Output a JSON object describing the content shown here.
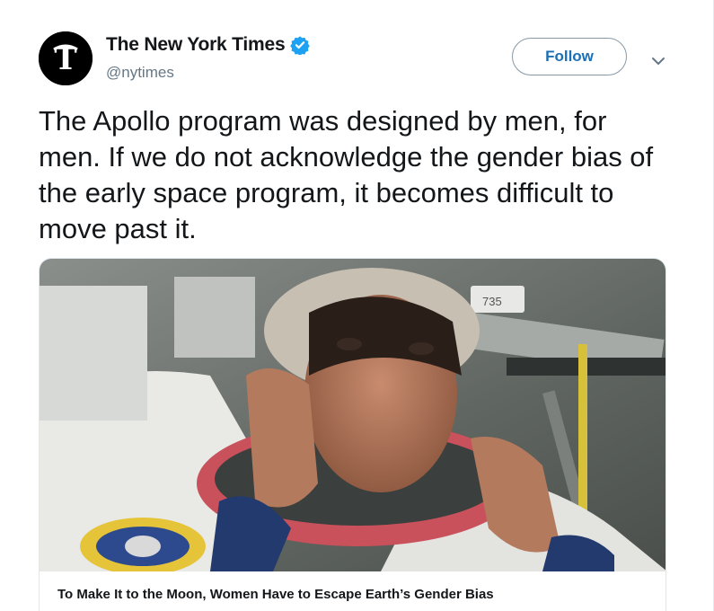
{
  "user": {
    "display_name": "The New York Times",
    "handle": "@nytimes",
    "avatar_icon": "nyt-logo-icon",
    "verified": true
  },
  "actions": {
    "follow_label": "Follow",
    "menu_icon": "chevron-down-icon"
  },
  "tweet": {
    "text": "The Apollo program was designed by men, for men. If we do not acknowledge the gender bias of the early space program, it becomes difficult to move past it."
  },
  "card": {
    "title": "To Make It to the Moon, Women Have to Escape Earth’s Gender Bias",
    "image_label": "735"
  },
  "colors": {
    "follow_text": "#1b6fb5",
    "verified": "#1da1f2",
    "handle": "#657786"
  }
}
